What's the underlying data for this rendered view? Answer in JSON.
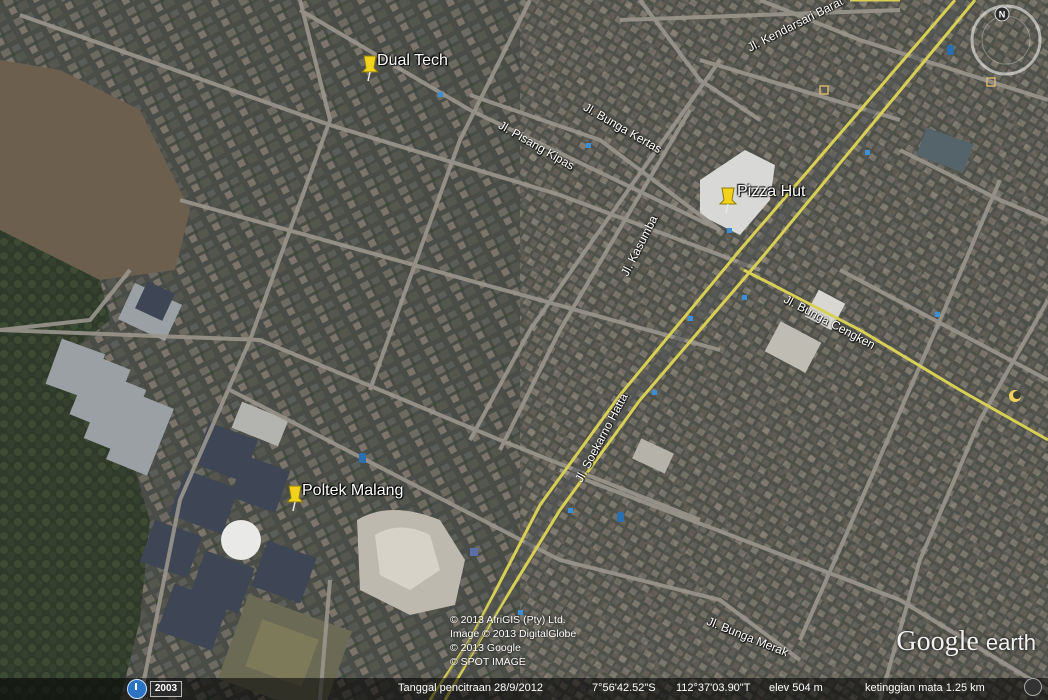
{
  "pins": [
    {
      "name": "Dual Tech"
    },
    {
      "name": "Pizza Hut"
    },
    {
      "name": "Poltek Malang"
    }
  ],
  "streets": [
    "Jl. Kendarsari Barat",
    "Jl. Bunga Kertas",
    "Jl. Pisang Kipas",
    "Jl. Kasumba",
    "Jl. Bunga Cengken",
    "Jl. Soekarno Hatta",
    "Jl. Bunga Merak"
  ],
  "credits": [
    "© 2013 AfriGIS (Pty) Ltd.",
    "Image © 2013 DigitalGlobe",
    "© 2013 Google",
    "© SPOT IMAGE"
  ],
  "logo": {
    "google": "Google",
    "earth": "earth"
  },
  "history": {
    "year": "2003"
  },
  "status": {
    "imagery_date": "Tanggal pencitraan 28/9/2012",
    "lat": "7°56'42.52\"S",
    "lon": "112°37'03.90\"T",
    "elev": "elev  504 m",
    "eye_alt": "ketinggian mata   1.25 km"
  },
  "compass": {
    "north": "N"
  },
  "colors": {
    "road_yellow": "#d8cf55",
    "pin_yellow": "#f2d21a",
    "imagery_base": "#3b3d38"
  }
}
